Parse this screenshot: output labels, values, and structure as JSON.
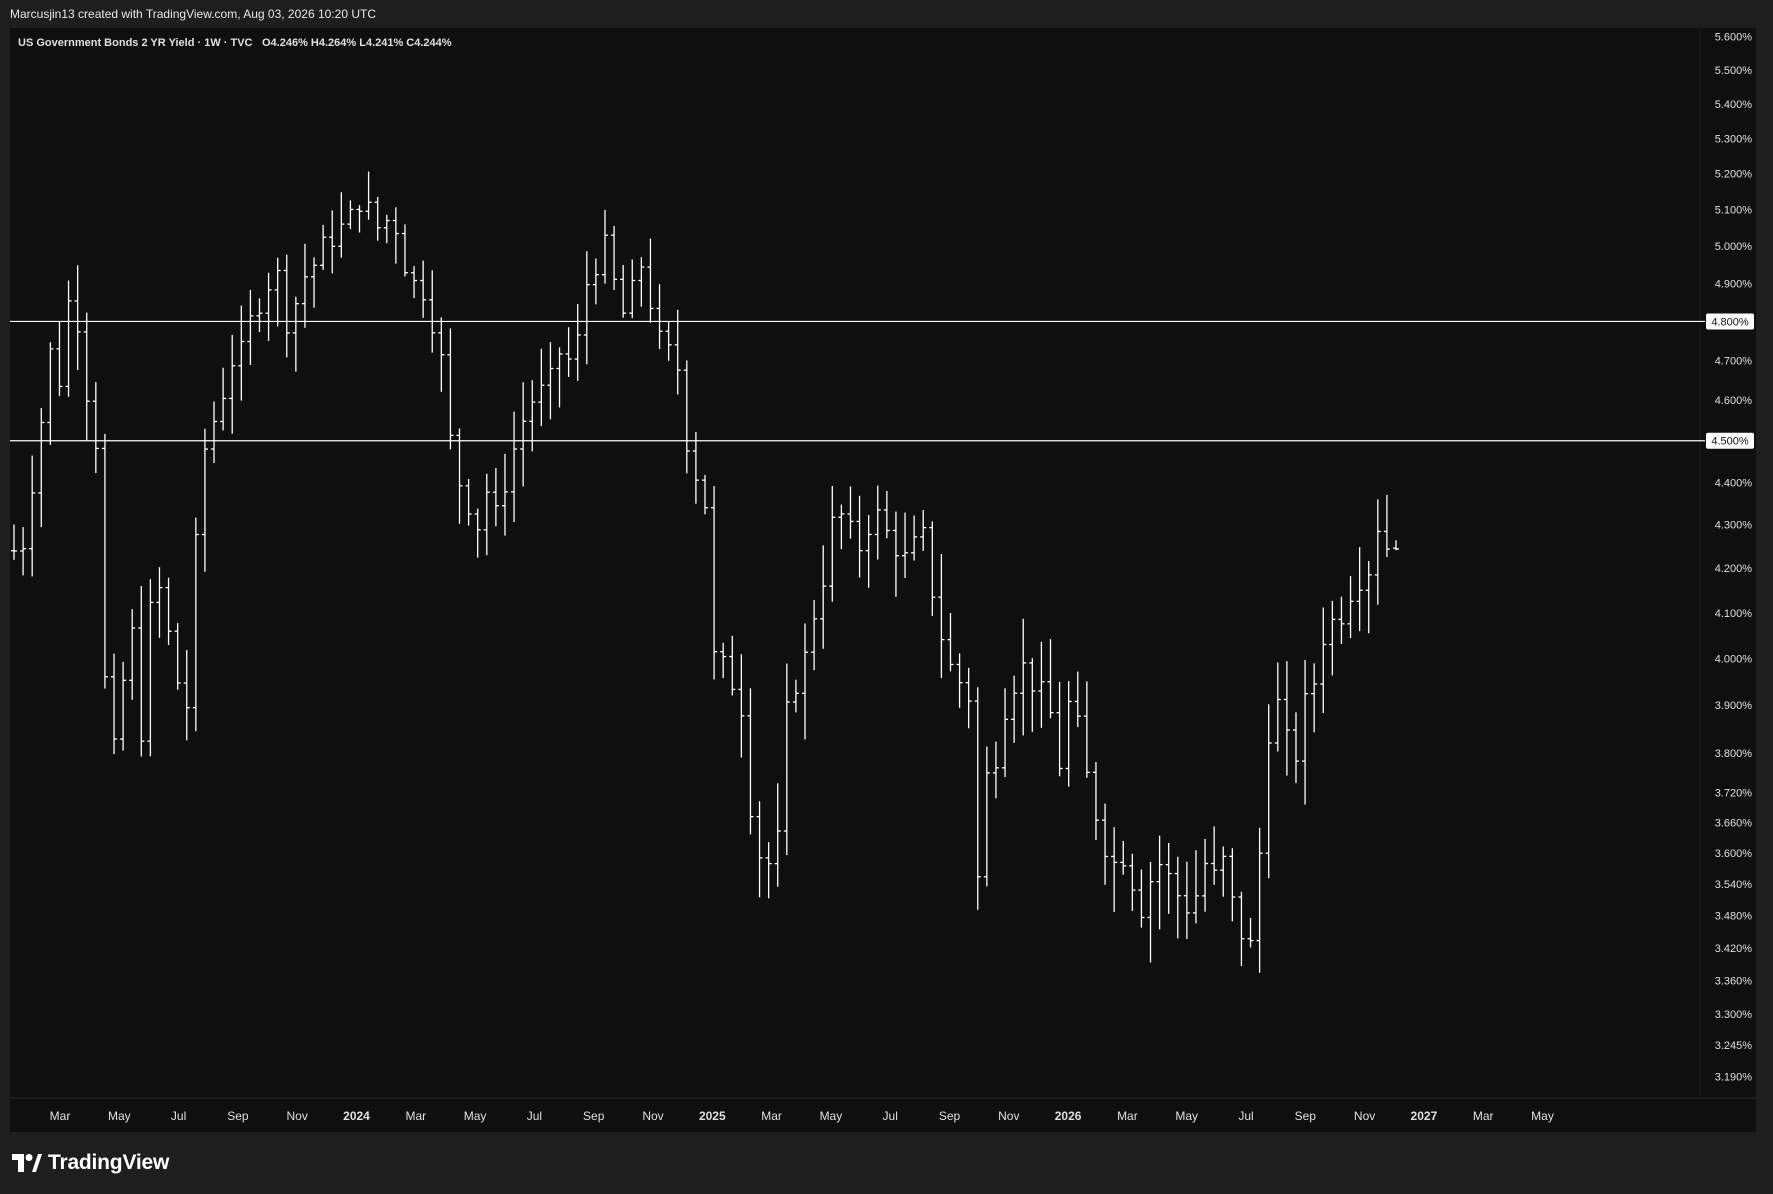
{
  "header": {
    "credit": "Marcusjin13 created with TradingView.com, Aug 03, 2026 10:20 UTC"
  },
  "brand": {
    "name": "TradingView",
    "logo_icon": "tradingview-logo-icon"
  },
  "colors": {
    "background": "#0f0f0f",
    "frame": "#1e1e1e",
    "bars": "#ffffff",
    "text": "#e0e0e0"
  },
  "chart_data": {
    "type": "ohlc",
    "title": "US Government Bonds 2 YR Yield · 1W · TVC",
    "ohlc_readout": {
      "open": "O4.246%",
      "high": "H4.264%",
      "low": "L4.241%",
      "close": "C4.244%"
    },
    "scale": "log",
    "ylim": [
      3.16,
      5.62
    ],
    "x_tick_labels": [
      "Mar",
      "May",
      "Jul",
      "Sep",
      "Nov",
      "2024",
      "Mar",
      "May",
      "Jul",
      "Sep",
      "Nov",
      "2025",
      "Mar",
      "May",
      "Jul",
      "Sep",
      "Nov",
      "2026",
      "Mar",
      "May",
      "Jul",
      "Sep",
      "Nov",
      "2027",
      "Mar",
      "May"
    ],
    "y_tick_labels": [
      "5.600%",
      "5.500%",
      "5.400%",
      "5.300%",
      "5.200%",
      "5.100%",
      "5.000%",
      "4.900%",
      "4.700%",
      "4.600%",
      "4.400%",
      "4.300%",
      "4.200%",
      "4.100%",
      "4.000%",
      "3.900%",
      "3.800%",
      "3.720%",
      "3.660%",
      "3.600%",
      "3.540%",
      "3.480%",
      "3.420%",
      "3.360%",
      "3.300%",
      "3.245%",
      "3.190%"
    ],
    "y_tick_values": [
      5.6,
      5.5,
      5.4,
      5.3,
      5.2,
      5.1,
      5.0,
      4.9,
      4.7,
      4.6,
      4.4,
      4.3,
      4.2,
      4.1,
      4.0,
      3.9,
      3.8,
      3.72,
      3.66,
      3.6,
      3.54,
      3.48,
      3.42,
      3.36,
      3.3,
      3.245,
      3.19
    ],
    "horizontal_lines": [
      {
        "value": 4.8,
        "label": "4.800%"
      },
      {
        "value": 4.5,
        "label": "4.500%"
      }
    ],
    "grid": false,
    "anchor_points": [
      [
        0,
        4.24
      ],
      [
        1,
        4.26
      ],
      [
        2,
        4.4
      ],
      [
        3,
        4.55
      ],
      [
        4,
        4.72
      ],
      [
        5,
        4.65
      ],
      [
        6,
        4.85
      ],
      [
        7,
        4.8
      ],
      [
        8,
        4.62
      ],
      [
        9,
        4.5
      ],
      [
        10,
        3.95
      ],
      [
        11,
        3.8
      ],
      [
        12,
        3.95
      ],
      [
        13,
        4.05
      ],
      [
        14,
        3.85
      ],
      [
        15,
        4.1
      ],
      [
        16,
        4.15
      ],
      [
        17,
        4.05
      ],
      [
        18,
        3.95
      ],
      [
        19,
        3.9
      ],
      [
        20,
        4.25
      ],
      [
        21,
        4.48
      ],
      [
        22,
        4.55
      ],
      [
        23,
        4.62
      ],
      [
        24,
        4.7
      ],
      [
        25,
        4.72
      ],
      [
        26,
        4.8
      ],
      [
        27,
        4.85
      ],
      [
        28,
        4.9
      ],
      [
        29,
        4.92
      ],
      [
        30,
        4.8
      ],
      [
        31,
        4.85
      ],
      [
        32,
        4.92
      ],
      [
        33,
        4.95
      ],
      [
        34,
        5.0
      ],
      [
        35,
        5.02
      ],
      [
        36,
        5.05
      ],
      [
        37,
        5.08
      ],
      [
        38,
        5.12
      ],
      [
        39,
        5.1
      ],
      [
        40,
        5.05
      ],
      [
        41,
        5.07
      ],
      [
        42,
        5.05
      ],
      [
        43,
        4.95
      ],
      [
        44,
        4.9
      ],
      [
        45,
        4.88
      ],
      [
        46,
        4.8
      ],
      [
        47,
        4.7
      ],
      [
        48,
        4.5
      ],
      [
        49,
        4.4
      ],
      [
        50,
        4.35
      ],
      [
        51,
        4.3
      ],
      [
        52,
        4.38
      ],
      [
        53,
        4.32
      ],
      [
        54,
        4.4
      ],
      [
        55,
        4.48
      ],
      [
        56,
        4.55
      ],
      [
        57,
        4.6
      ],
      [
        58,
        4.62
      ],
      [
        59,
        4.65
      ],
      [
        60,
        4.72
      ],
      [
        61,
        4.7
      ],
      [
        62,
        4.75
      ],
      [
        63,
        4.9
      ],
      [
        64,
        4.95
      ],
      [
        65,
        5.0
      ],
      [
        66,
        4.9
      ],
      [
        67,
        4.82
      ],
      [
        68,
        4.88
      ],
      [
        69,
        4.95
      ],
      [
        70,
        4.85
      ],
      [
        71,
        4.75
      ],
      [
        72,
        4.72
      ],
      [
        73,
        4.68
      ],
      [
        74,
        4.5
      ],
      [
        75,
        4.42
      ],
      [
        76,
        4.35
      ],
      [
        77,
        4.0
      ],
      [
        78,
        3.98
      ],
      [
        79,
        3.95
      ],
      [
        80,
        3.9
      ],
      [
        81,
        3.7
      ],
      [
        82,
        3.6
      ],
      [
        83,
        3.58
      ],
      [
        84,
        3.62
      ],
      [
        85,
        3.88
      ],
      [
        86,
        3.95
      ],
      [
        87,
        4.0
      ],
      [
        88,
        4.1
      ],
      [
        89,
        4.18
      ],
      [
        90,
        4.3
      ],
      [
        91,
        4.32
      ],
      [
        92,
        4.28
      ],
      [
        93,
        4.25
      ],
      [
        94,
        4.3
      ],
      [
        95,
        4.32
      ],
      [
        96,
        4.28
      ],
      [
        97,
        4.25
      ],
      [
        98,
        4.22
      ],
      [
        99,
        4.25
      ],
      [
        100,
        4.27
      ],
      [
        101,
        4.15
      ],
      [
        102,
        4.05
      ],
      [
        103,
        3.98
      ],
      [
        104,
        3.95
      ],
      [
        105,
        3.92
      ],
      [
        106,
        3.55
      ],
      [
        107,
        3.75
      ],
      [
        108,
        3.8
      ],
      [
        109,
        3.9
      ],
      [
        110,
        3.95
      ],
      [
        111,
        3.98
      ],
      [
        112,
        3.95
      ],
      [
        113,
        3.92
      ],
      [
        114,
        3.88
      ],
      [
        115,
        3.78
      ],
      [
        116,
        3.9
      ],
      [
        117,
        3.85
      ],
      [
        118,
        3.75
      ],
      [
        119,
        3.68
      ],
      [
        120,
        3.62
      ],
      [
        121,
        3.58
      ],
      [
        122,
        3.6
      ],
      [
        123,
        3.55
      ],
      [
        124,
        3.5
      ],
      [
        125,
        3.55
      ],
      [
        126,
        3.58
      ],
      [
        127,
        3.55
      ],
      [
        128,
        3.52
      ],
      [
        129,
        3.5
      ],
      [
        130,
        3.52
      ],
      [
        131,
        3.58
      ],
      [
        132,
        3.55
      ],
      [
        133,
        3.58
      ],
      [
        134,
        3.5
      ],
      [
        135,
        3.45
      ],
      [
        136,
        3.42
      ],
      [
        137,
        3.6
      ],
      [
        138,
        3.85
      ],
      [
        139,
        3.9
      ],
      [
        140,
        3.82
      ],
      [
        141,
        3.8
      ],
      [
        142,
        3.9
      ],
      [
        143,
        3.95
      ],
      [
        144,
        4.05
      ],
      [
        145,
        4.08
      ],
      [
        146,
        4.1
      ],
      [
        147,
        4.15
      ],
      [
        148,
        4.18
      ],
      [
        149,
        4.2
      ],
      [
        150,
        4.3
      ],
      [
        151,
        4.25
      ],
      [
        152,
        4.245
      ]
    ]
  }
}
